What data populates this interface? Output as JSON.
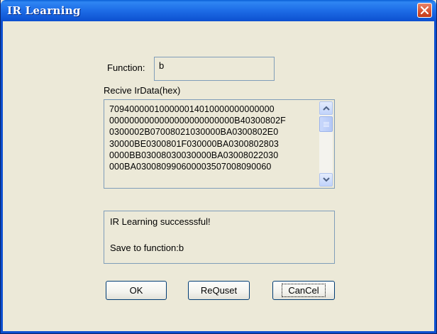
{
  "window": {
    "title": "IR Learning"
  },
  "function_field": {
    "label": "Function:",
    "value": "b"
  },
  "ir_data": {
    "label": "Recive IrData(hex)",
    "lines": [
      "709400000100000014010000000000000",
      "0000000000000000000000000B40300802F",
      "0300002B07008021030000BA0300802E0",
      "30000BE0300801F030000BA0300802803",
      "0000BB03008030030000BA03008022030",
      "000BA030080990600003507008090060"
    ]
  },
  "status": {
    "line1": "IR Learning successsful!",
    "line2": "Save to function:b"
  },
  "buttons": {
    "ok": "OK",
    "request": "ReQuset",
    "cancel": "CanCel"
  },
  "colors": {
    "titlebar": "#0c4fd0",
    "dialog_bg": "#ece9d8",
    "field_border": "#7f9db9",
    "close_button": "#d8512e"
  }
}
